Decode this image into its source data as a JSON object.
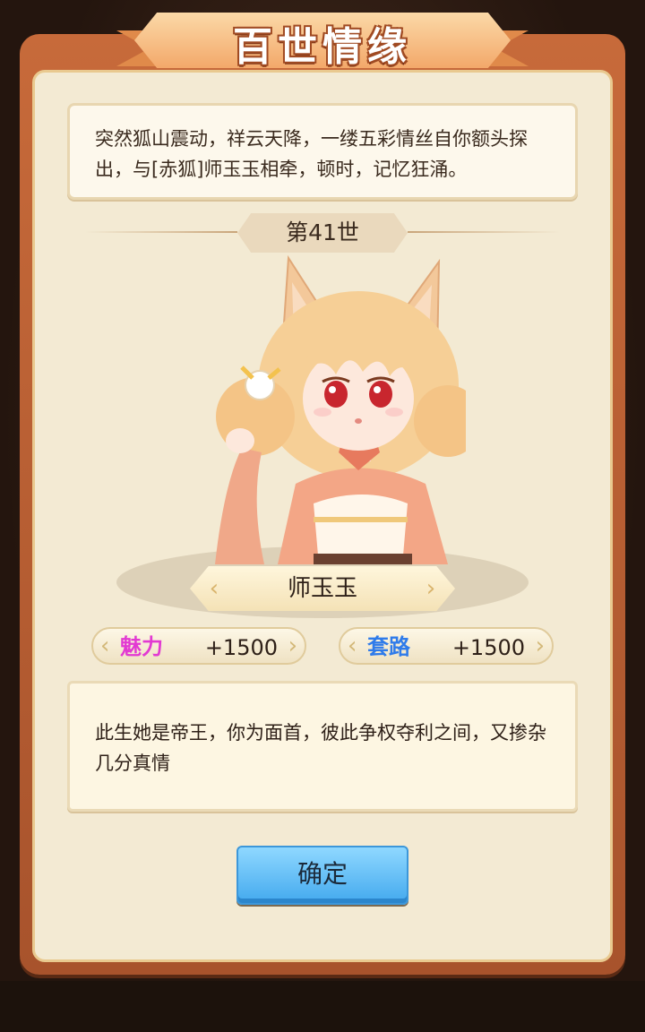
{
  "title": "百世情缘",
  "story": "突然狐山震动，祥云天降，一缕五彩情丝自你额头探出，与[赤狐]师玉玉相牵，顿时，记忆狂涌。",
  "life_label": "第41世",
  "character_name": "师玉玉",
  "stats": [
    {
      "label": "魅力",
      "value": "+1500",
      "color": "#e23ad2"
    },
    {
      "label": "套路",
      "value": "+1500",
      "color": "#2f7bea"
    }
  ],
  "description": "此生她是帝王，你为面首，彼此争权夺利之间，又掺杂几分真情",
  "confirm_label": "确定",
  "colors": {
    "frame": "#c76a3a",
    "panel": "#f3ead3",
    "button": "#43a9ee"
  }
}
